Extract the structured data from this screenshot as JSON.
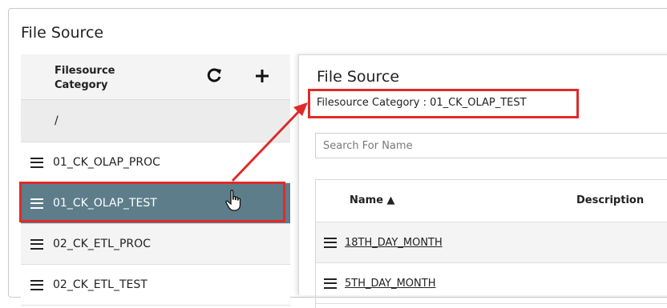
{
  "app": {
    "title": "File Source"
  },
  "left_panel": {
    "header_label": "Filesource Category",
    "refresh_icon": "refresh-icon",
    "add_icon": "plus-icon",
    "root_label": "/",
    "categories": [
      {
        "label": "01_CK_OLAP_PROC",
        "selected": false
      },
      {
        "label": "01_CK_OLAP_TEST",
        "selected": true
      },
      {
        "label": "02_CK_ETL_PROC",
        "selected": false
      },
      {
        "label": "02_CK_ETL_TEST",
        "selected": false
      }
    ]
  },
  "right_panel": {
    "title": "File Source",
    "breadcrumb": "Filesource Category : 01_CK_OLAP_TEST",
    "search_placeholder": "Search For Name",
    "columns": {
      "name": "Name ▲",
      "description": "Description"
    },
    "rows": [
      {
        "name": "18TH_DAY_MONTH"
      },
      {
        "name": "5TH_DAY_MONTH"
      }
    ]
  },
  "colors": {
    "selected_row": "#5d7d8a",
    "annotation": "#e02a2a"
  }
}
